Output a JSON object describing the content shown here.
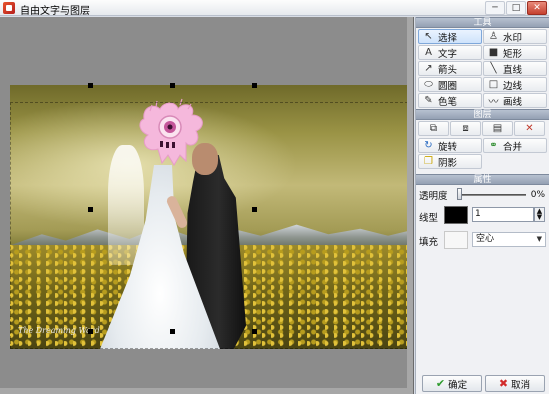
{
  "window": {
    "title": "自由文字与图层",
    "minimize_glyph": "─",
    "maximize_glyph": "□",
    "close_glyph": "✕"
  },
  "canvas": {
    "photo_signature": "The Dreaming Ward"
  },
  "panel": {
    "tools": {
      "header": "工具",
      "buttons": [
        {
          "label": "选择",
          "icon": "cursor-icon",
          "glyph": "↖",
          "active": true
        },
        {
          "label": "水印",
          "icon": "stamp-icon",
          "glyph": "♙",
          "active": false
        },
        {
          "label": "文字",
          "icon": "text-icon",
          "glyph": "A",
          "active": false
        },
        {
          "label": "矩形",
          "icon": "rectangle-icon",
          "glyph": "■",
          "active": false
        },
        {
          "label": "箭头",
          "icon": "arrow-icon",
          "glyph": "↗",
          "active": false
        },
        {
          "label": "直线",
          "icon": "line-icon",
          "glyph": "╲",
          "active": false
        },
        {
          "label": "圆圈",
          "icon": "ellipse-icon",
          "glyph": "⬭",
          "active": false
        },
        {
          "label": "边线",
          "icon": "border-icon",
          "glyph": "□",
          "active": false
        },
        {
          "label": "色笔",
          "icon": "pen-icon",
          "glyph": "✎",
          "active": false
        },
        {
          "label": "画线",
          "icon": "freehand-icon",
          "glyph": "〰",
          "active": false
        }
      ]
    },
    "layers": {
      "header": "图层",
      "icon_buttons": [
        {
          "icon": "bring-forward-icon",
          "glyph": "⧉"
        },
        {
          "icon": "send-backward-icon",
          "glyph": "⧈"
        },
        {
          "icon": "copy-layer-icon",
          "glyph": "▤"
        },
        {
          "icon": "delete-icon",
          "glyph": "✕"
        }
      ],
      "buttons": [
        {
          "label": "旋转",
          "icon": "rotate-icon",
          "glyph": "↻"
        },
        {
          "label": "合并",
          "icon": "merge-icon",
          "glyph": "⚭"
        },
        {
          "label": "阴影",
          "icon": "shadow-icon",
          "glyph": "❐"
        }
      ]
    },
    "properties": {
      "header": "属性",
      "opacity_label": "透明度",
      "opacity_value": "0%",
      "opacity_fraction": 0,
      "line_label": "线型",
      "line_color": "#000000",
      "line_width": "1",
      "fill_label": "填充",
      "fill_color": "#f7f7f7",
      "fill_mode": "空心"
    },
    "footer": {
      "ok_label": "确定",
      "cancel_label": "取消"
    }
  },
  "colors": {
    "canvas_bg": "#8c8c8c",
    "panel_header": "#94a0b3",
    "sticker_pink": "#f5b8dc",
    "ok_green": "#2e9b2e",
    "cancel_red": "#d12a2a"
  }
}
